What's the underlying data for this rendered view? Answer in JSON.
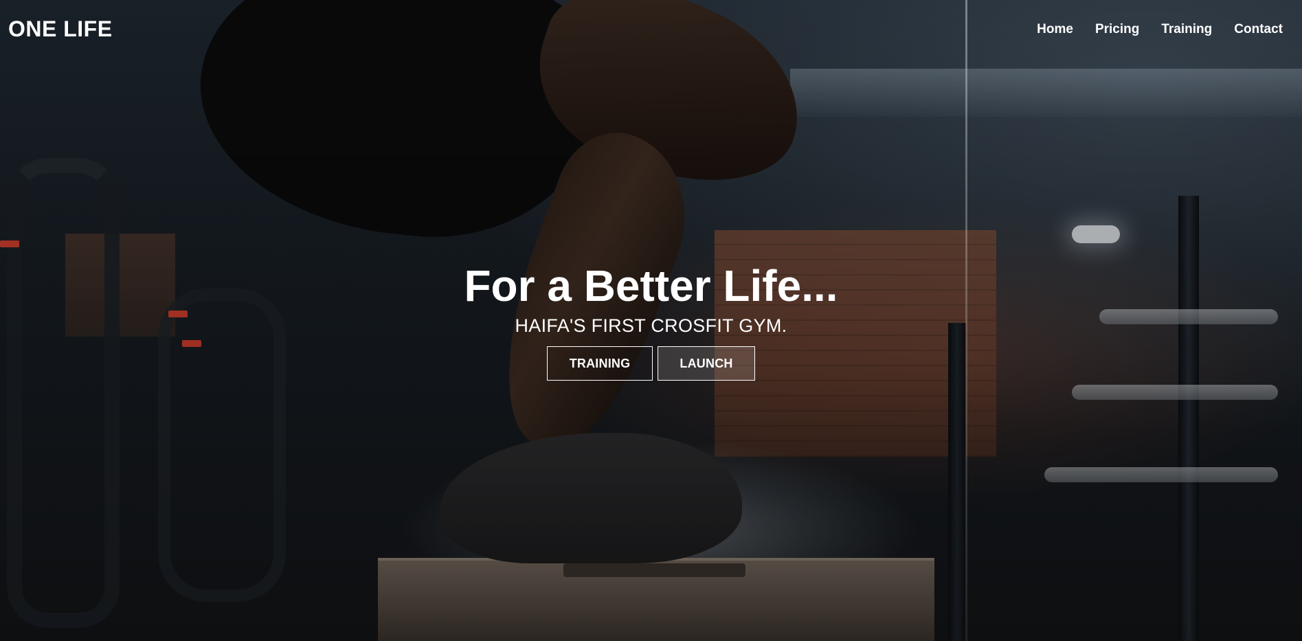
{
  "header": {
    "logo": "ONE LIFE",
    "nav": [
      {
        "label": "Home"
      },
      {
        "label": "Pricing"
      },
      {
        "label": "Training"
      },
      {
        "label": "Contact"
      }
    ]
  },
  "hero": {
    "title": "For a Better Life...",
    "subtitle": "HAIFA'S FIRST CROSFIT GYM.",
    "buttons": [
      {
        "label": "TRAINING"
      },
      {
        "label": "LAUNCH"
      }
    ]
  },
  "colors": {
    "text": "#ffffff",
    "background": "#121417"
  }
}
